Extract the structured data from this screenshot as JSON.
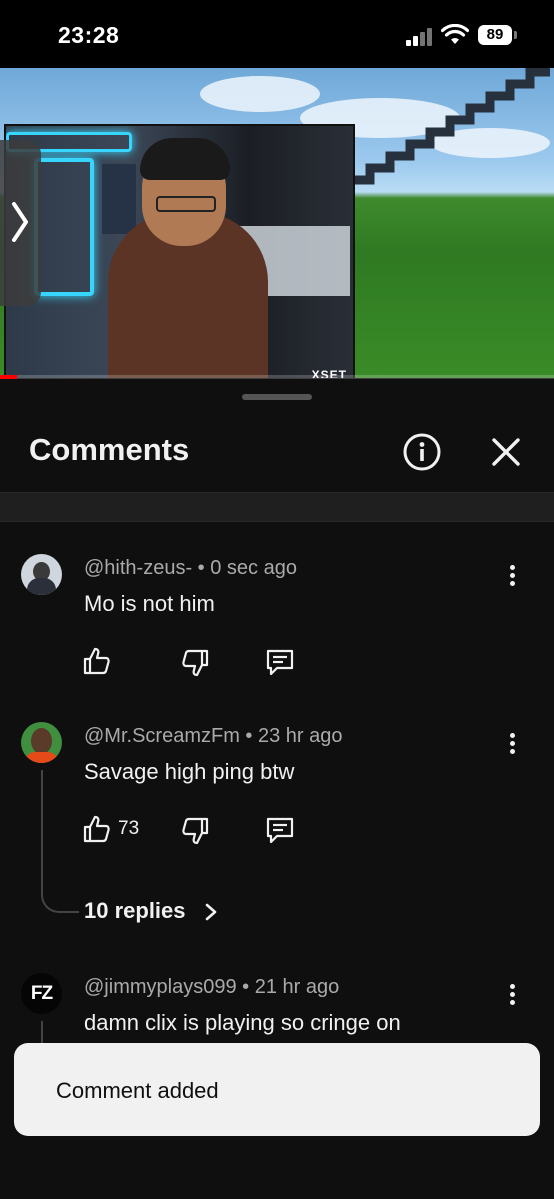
{
  "status_bar": {
    "time": "23:28",
    "battery": "89"
  },
  "video": {
    "progress_fraction": 0.03,
    "overlay_brand": "XSET"
  },
  "sheet": {
    "title": "Comments",
    "info_icon": "info-icon",
    "close_icon": "close-icon"
  },
  "comments": [
    {
      "author": "@hith-zeus-",
      "time": "0 sec ago",
      "text": "Mo is not him",
      "likes": ""
    },
    {
      "author": "@Mr.ScreamzFm",
      "time": "23 hr ago",
      "text": "Savage high ping btw",
      "likes": "73",
      "replies_label": "10 replies"
    },
    {
      "author": "@jimmyplays099",
      "time": "21 hr ago",
      "text": "damn clix is playing so cringe on",
      "avatar_text": "FZ"
    }
  ],
  "toast": {
    "text": "Comment added"
  },
  "colors": {
    "background": "#0f0f0f",
    "accent_progress": "#ff0000",
    "toast_bg": "#f1f1f1"
  }
}
